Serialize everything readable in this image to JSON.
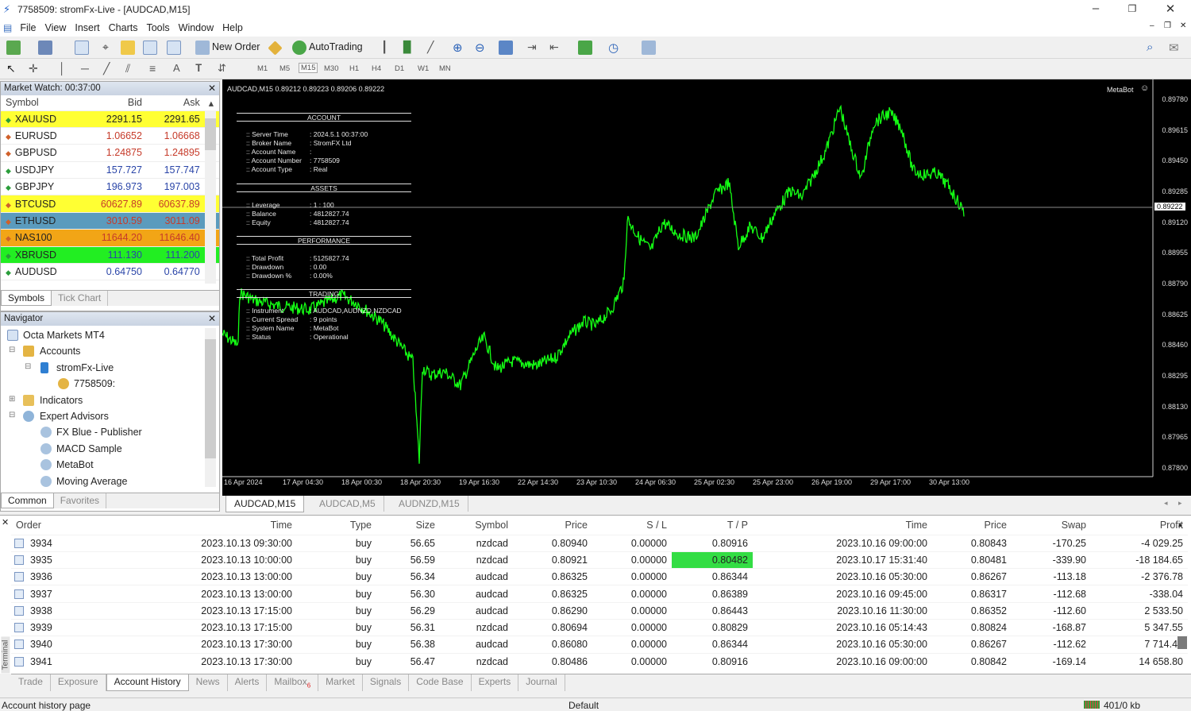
{
  "window": {
    "title": "7758509: stromFx-Live - [AUDCAD,M15]"
  },
  "menu": [
    "File",
    "View",
    "Insert",
    "Charts",
    "Tools",
    "Window",
    "Help"
  ],
  "toolbar": {
    "new_order": "New Order",
    "autotrading": "AutoTrading",
    "timeframes": [
      "M1",
      "M5",
      "M15",
      "M30",
      "H1",
      "H4",
      "D1",
      "W1",
      "MN"
    ]
  },
  "market_watch": {
    "title": "Market Watch: 00:37:00",
    "headers": {
      "symbol": "Symbol",
      "bid": "Bid",
      "ask": "Ask"
    },
    "rows": [
      {
        "symbol": "XAUUSD",
        "bid": "2291.15",
        "ask": "2291.65",
        "bg": "#ffff33",
        "fg": "#222",
        "icon": "#2a9d3a"
      },
      {
        "symbol": "EURUSD",
        "bid": "1.06652",
        "ask": "1.06668",
        "bg": "#ffffff",
        "fg": "#c63b2a",
        "icon": "#d0602a"
      },
      {
        "symbol": "GBPUSD",
        "bid": "1.24875",
        "ask": "1.24895",
        "bg": "#ffffff",
        "fg": "#c63b2a",
        "icon": "#d0602a"
      },
      {
        "symbol": "USDJPY",
        "bid": "157.727",
        "ask": "157.747",
        "bg": "#ffffff",
        "fg": "#2a45a8",
        "icon": "#2a9d3a"
      },
      {
        "symbol": "GBPJPY",
        "bid": "196.973",
        "ask": "197.003",
        "bg": "#ffffff",
        "fg": "#2a45a8",
        "icon": "#2a9d3a"
      },
      {
        "symbol": "BTCUSD",
        "bid": "60627.89",
        "ask": "60637.89",
        "bg": "#ffff33",
        "fg": "#c63b2a",
        "icon": "#d0602a"
      },
      {
        "symbol": "ETHUSD",
        "bid": "3010.59",
        "ask": "3011.09",
        "bg": "#5b9bbd",
        "fg": "#c63b2a",
        "icon": "#d0602a"
      },
      {
        "symbol": "NAS100",
        "bid": "11644.20",
        "ask": "11646.40",
        "bg": "#f2a516",
        "fg": "#c63b2a",
        "icon": "#d0602a"
      },
      {
        "symbol": "XBRUSD",
        "bid": "111.130",
        "ask": "111.200",
        "bg": "#22ee22",
        "fg": "#2a45a8",
        "icon": "#2a9d3a"
      },
      {
        "symbol": "AUDUSD",
        "bid": "0.64750",
        "ask": "0.64770",
        "bg": "#ffffff",
        "fg": "#2a45a8",
        "icon": "#2a9d3a"
      }
    ],
    "tabs": [
      "Symbols",
      "Tick Chart"
    ]
  },
  "navigator": {
    "title": "Navigator",
    "items": [
      "Octa Markets MT4",
      "Accounts",
      "stromFx-Live",
      "7758509:",
      "Indicators",
      "Expert Advisors",
      "FX Blue - Publisher",
      "MACD Sample",
      "MetaBot",
      "Moving Average"
    ],
    "tabs": [
      "Common",
      "Favorites"
    ]
  },
  "chart": {
    "header": "AUDCAD,M15  0.89212 0.89223 0.89206 0.89222",
    "ea": "MetaBot",
    "current_price": "0.89222",
    "price_labels": [
      "0.89780",
      "0.89615",
      "0.89450",
      "0.89285",
      "0.89120",
      "0.88955",
      "0.88790",
      "0.88625",
      "0.88460",
      "0.88295",
      "0.88130",
      "0.87965",
      "0.87800"
    ],
    "date_labels": [
      "16 Apr 2024",
      "17 Apr 04:30",
      "18 Apr 00:30",
      "18 Apr 20:30",
      "19 Apr 16:30",
      "22 Apr 14:30",
      "23 Apr 10:30",
      "24 Apr 06:30",
      "25 Apr 02:30",
      "25 Apr 23:00",
      "26 Apr 19:00",
      "29 Apr 17:00",
      "30 Apr 13:00"
    ],
    "overlay": {
      "account_title": "ACCOUNT",
      "account": [
        [
          "Server Time",
          "2024.5.1 00:37:00"
        ],
        [
          "Broker Name",
          "StromFX Ltd"
        ],
        [
          "Account Name",
          ""
        ],
        [
          "Account Number",
          "7758509"
        ],
        [
          "Account Type",
          "Real"
        ]
      ],
      "assets_title": "ASSETS",
      "assets": [
        [
          "Leverage",
          "1 : 100"
        ],
        [
          "Balance",
          "4812827.74"
        ],
        [
          "Equity",
          "4812827.74"
        ]
      ],
      "performance_title": "PERFORMANCE",
      "performance": [
        [
          "Total Profit",
          "5125827.74"
        ],
        [
          "Drawdown",
          "0.00"
        ],
        [
          "Drawdown %",
          "0.00%"
        ]
      ],
      "trading_title": "TRADING",
      "trading": [
        [
          "Instrument",
          "AUDCAD,AUDNZD,NZDCAD"
        ],
        [
          "Current Spread",
          "9 points"
        ],
        [
          "System Name",
          "MetaBot"
        ],
        [
          "Status",
          "Operational"
        ]
      ]
    },
    "tabs": [
      "AUDCAD,M15",
      "AUDCAD,M5",
      "AUDNZD,M15"
    ]
  },
  "terminal": {
    "headers": [
      "Order",
      "Time",
      "Type",
      "Size",
      "Symbol",
      "Price",
      "S / L",
      "T / P",
      "Time",
      "Price",
      "Swap",
      "Profit"
    ],
    "rows": [
      [
        "3934",
        "2023.10.13 09:30:00",
        "buy",
        "56.65",
        "nzdcad",
        "0.80940",
        "0.00000",
        "0.80916",
        "2023.10.16 09:00:00",
        "0.80843",
        "-170.25",
        "-4 029.25"
      ],
      [
        "3935",
        "2023.10.13 10:00:00",
        "buy",
        "56.59",
        "nzdcad",
        "0.80921",
        "0.00000",
        "0.80482",
        "2023.10.17 15:31:40",
        "0.80481",
        "-339.90",
        "-18 184.65"
      ],
      [
        "3936",
        "2023.10.13 13:00:00",
        "buy",
        "56.34",
        "audcad",
        "0.86325",
        "0.00000",
        "0.86344",
        "2023.10.16 05:30:00",
        "0.86267",
        "-113.18",
        "-2 376.78"
      ],
      [
        "3937",
        "2023.10.13 13:00:00",
        "buy",
        "56.30",
        "audcad",
        "0.86325",
        "0.00000",
        "0.86389",
        "2023.10.16 09:45:00",
        "0.86317",
        "-112.68",
        "-338.04"
      ],
      [
        "3938",
        "2023.10.13 17:15:00",
        "buy",
        "56.29",
        "audcad",
        "0.86290",
        "0.00000",
        "0.86443",
        "2023.10.16 11:30:00",
        "0.86352",
        "-112.60",
        "2 533.50"
      ],
      [
        "3939",
        "2023.10.13 17:15:00",
        "buy",
        "56.31",
        "nzdcad",
        "0.80694",
        "0.00000",
        "0.80829",
        "2023.10.16 05:14:43",
        "0.80824",
        "-168.87",
        "5 347.55"
      ],
      [
        "3940",
        "2023.10.13 17:30:00",
        "buy",
        "56.38",
        "audcad",
        "0.86080",
        "0.00000",
        "0.86344",
        "2023.10.16 05:30:00",
        "0.86267",
        "-112.62",
        "7 714.47"
      ],
      [
        "3941",
        "2023.10.13 17:30:00",
        "buy",
        "56.47",
        "nzdcad",
        "0.80486",
        "0.00000",
        "0.80916",
        "2023.10.16 09:00:00",
        "0.80842",
        "-169.14",
        "14 658.80"
      ]
    ],
    "highlight": {
      "row": 1,
      "col": 7,
      "color": "#33dd44"
    },
    "side_label": "Terminal",
    "tabs": [
      "Trade",
      "Exposure",
      "Account History",
      "News",
      "Alerts",
      "Mailbox",
      "Market",
      "Signals",
      "Code Base",
      "Experts",
      "Journal"
    ],
    "mailbox_badge": "6"
  },
  "status": {
    "left": "Account history page",
    "profile": "Default",
    "traffic": "401/0 kb"
  }
}
